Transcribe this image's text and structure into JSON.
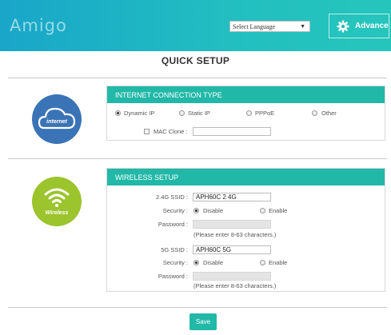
{
  "header": {
    "logo": "Amigo",
    "language_select": "Select Language",
    "advance_label": "Advance"
  },
  "page_title": "QUICK SETUP",
  "internet_icon": {
    "label": "internet",
    "color": "#3a74b6"
  },
  "wireless_icon": {
    "label": "Wireless",
    "color": "#9bc42d"
  },
  "connection": {
    "title": "INTERNET CONNECTION TYPE",
    "options": [
      "Dynamic IP",
      "Static IP",
      "PPPoE",
      "Other"
    ],
    "selected": "Dynamic IP",
    "mac_clone_label": "MAC Clone :",
    "mac_clone_value": ""
  },
  "wireless": {
    "title": "WIRELESS SETUP",
    "band24": {
      "ssid_label": "2.4G SSID :",
      "ssid_value": "APH60C 2 4G",
      "security_label": "Security :",
      "disable_label": "Disable",
      "enable_label": "Enable",
      "selected": "Disable",
      "password_label": "Password :",
      "password_value": "",
      "hint": "(Please enter 8-63 characters.)"
    },
    "band5": {
      "ssid_label": "5G SSID :",
      "ssid_value": "APH60C 5G",
      "security_label": "Security :",
      "disable_label": "Disable",
      "enable_label": "Enable",
      "selected": "Disable",
      "password_label": "Password :",
      "password_value": "",
      "hint": "(Please enter 8-63 characters.)"
    }
  },
  "save_label": "Save",
  "colors": {
    "header_start": "#19a6c9",
    "header_end": "#26c5bb",
    "accent": "#22b8a8"
  }
}
